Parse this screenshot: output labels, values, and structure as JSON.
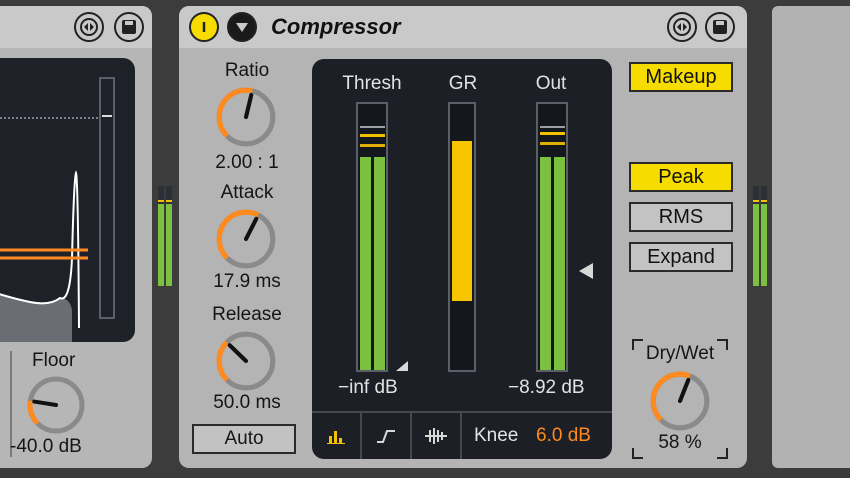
{
  "left_device": {
    "floor_label": "Floor",
    "floor_value": "-40.0 dB",
    "floor_fraction": 0.2
  },
  "compressor": {
    "title": "Compressor",
    "ratio": {
      "label": "Ratio",
      "value": "2.00 : 1",
      "fraction": 0.55
    },
    "attack": {
      "label": "Attack",
      "value": "17.9 ms",
      "fraction": 0.6
    },
    "release": {
      "label": "Release",
      "value": "50.0 ms",
      "fraction": 0.33
    },
    "auto_label": "Auto",
    "meters": {
      "thresh_label": "Thresh",
      "gr_label": "GR",
      "out_label": "Out",
      "thresh_reading": "−inf dB",
      "out_reading": "−8.92 dB",
      "thresh_level": 0.8,
      "gr_level": 0.6,
      "out_level": 0.8
    },
    "footer": {
      "knee_label": "Knee",
      "knee_value": "6.0 dB"
    },
    "buttons": {
      "makeup": "Makeup",
      "peak": "Peak",
      "rms": "RMS",
      "expand": "Expand"
    },
    "drywet": {
      "label": "Dry/Wet",
      "value": "58 %",
      "fraction": 0.58
    },
    "colors": {
      "accent_yellow": "#f7dc00",
      "knob_orange": "#ff8a1f",
      "meter_green": "#7bc13f",
      "gr_yellow": "#f7c400"
    }
  },
  "icons": [
    "power-icon",
    "dropdown-icon",
    "hot-swap-icon",
    "save-icon",
    "lin-mode-icon",
    "envelope-mode-icon",
    "sidechain-mode-icon"
  ]
}
